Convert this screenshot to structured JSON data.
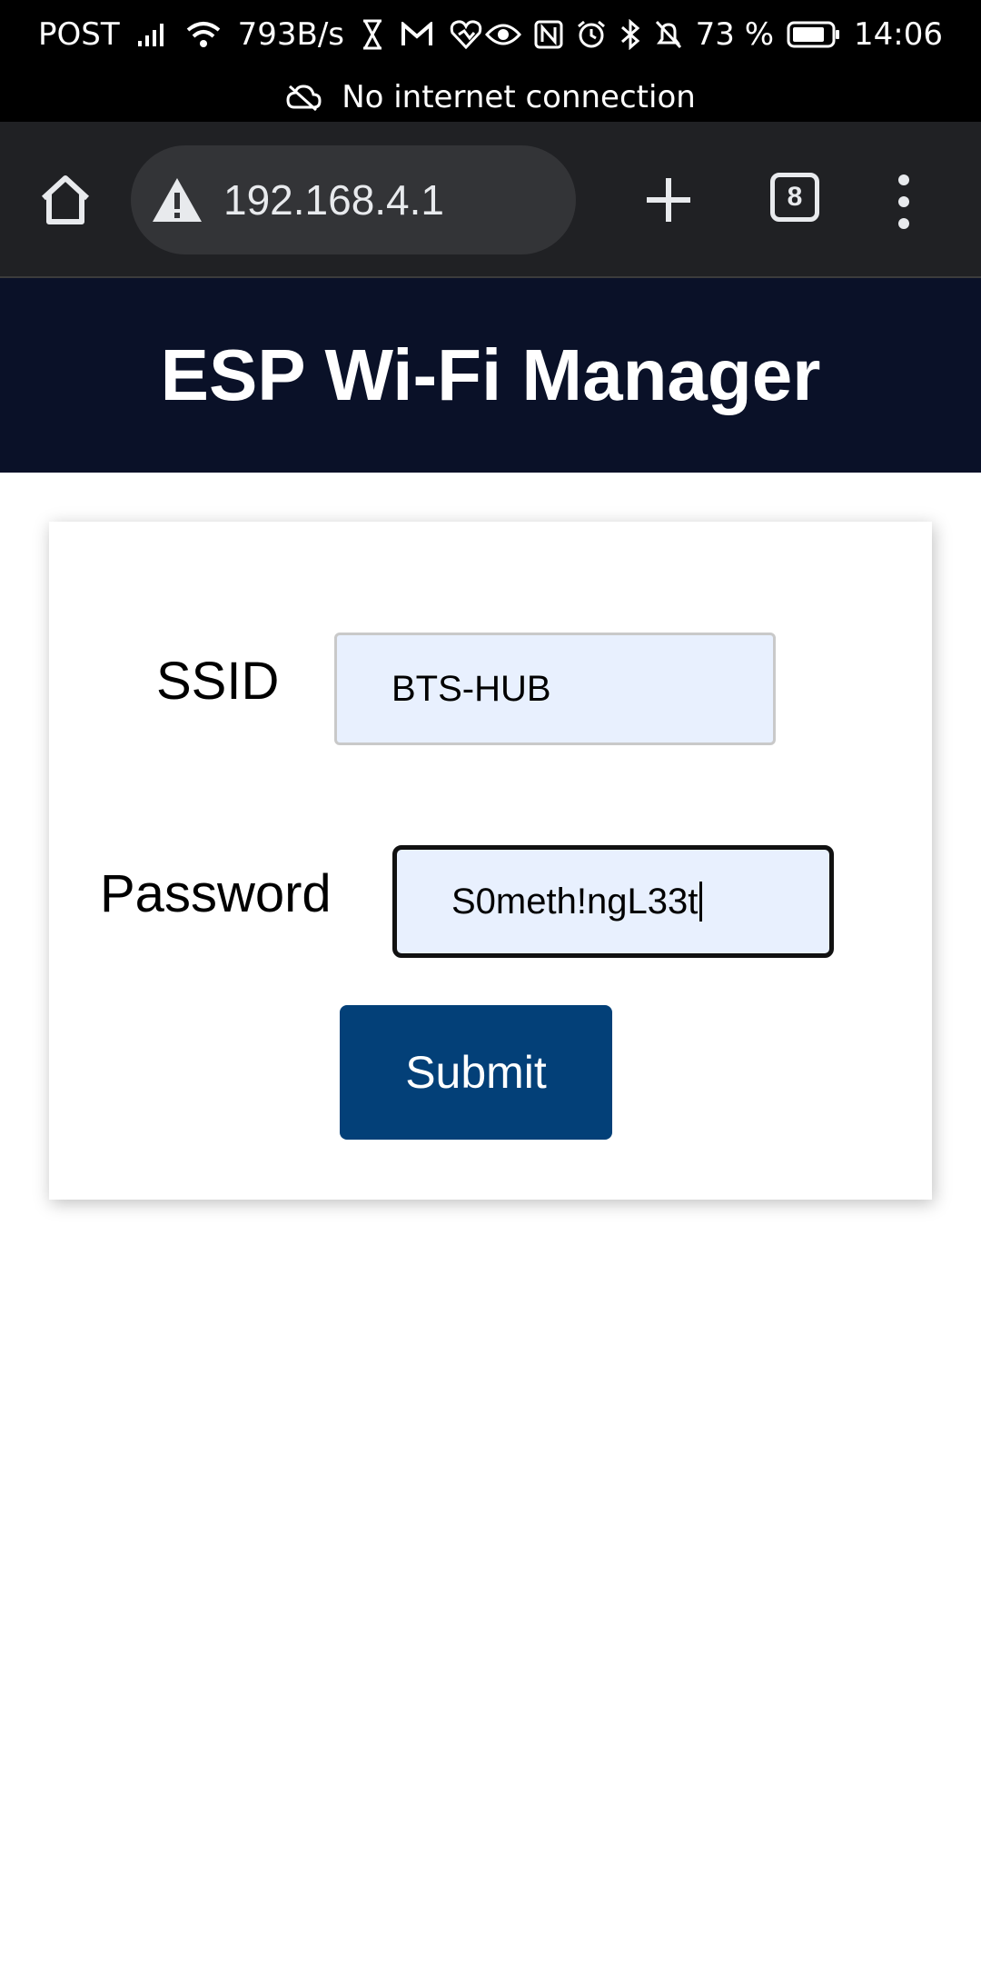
{
  "status_bar": {
    "carrier": "POST",
    "network_speed": "793B/s",
    "battery_percent": "73 %",
    "time": "14:06",
    "connection_banner": "No internet connection",
    "icons": [
      "signal-icon",
      "wifi-icon",
      "hourglass-icon",
      "gmail-icon",
      "health-icon",
      "eye-icon",
      "nfc-icon",
      "alarm-icon",
      "bluetooth-icon",
      "bell-off-icon",
      "battery-icon",
      "cloud-off-icon"
    ]
  },
  "browser": {
    "url": "192.168.4.1",
    "tab_count": "8",
    "icons": [
      "home-icon",
      "warning-icon",
      "plus-icon",
      "tabs-icon",
      "more-vert-icon"
    ]
  },
  "page": {
    "title": "ESP Wi-Fi Manager",
    "ssid_label": "SSID",
    "ssid_value": "BTS-HUB",
    "password_label": "Password",
    "password_value": "S0meth!ngL33t",
    "submit_label": "Submit"
  },
  "colors": {
    "header_bg": "#0a1128",
    "button_bg": "#034078",
    "field_bg": "#e8f0fe",
    "browser_bg": "#202124"
  }
}
